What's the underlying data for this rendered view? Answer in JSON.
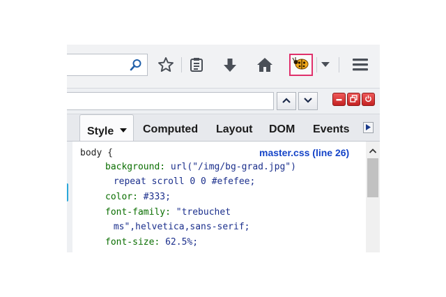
{
  "tabs": {
    "items": [
      {
        "label": "Style",
        "active": true
      },
      {
        "label": "Computed",
        "active": false
      },
      {
        "label": "Layout",
        "active": false
      },
      {
        "label": "DOM",
        "active": false
      },
      {
        "label": "Events",
        "active": false
      }
    ]
  },
  "rule": {
    "source": "master.css (line 26)",
    "selector_line": "body {",
    "declarations": [
      {
        "prop": "background:",
        "value": " url(\"/img/bg-grad.jpg\")"
      },
      {
        "prop": "",
        "value": " repeat scroll 0 0 #efefee;"
      },
      {
        "prop": "color:",
        "value": " #333;"
      },
      {
        "prop": "font-family:",
        "value": " \"trebuchet"
      },
      {
        "prop": "",
        "value": " ms\",helvetica,sans-serif;"
      },
      {
        "prop": "font-size:",
        "value": " 62.5%;"
      }
    ]
  },
  "icons": {
    "search": "search-icon",
    "bookmark": "star-icon",
    "reading_list": "clipboard-icon",
    "download": "download-arrow-icon",
    "home": "home-icon",
    "extension": "ladybug-icon",
    "menu": "hamburger-icon"
  },
  "colors": {
    "highlight_border": "#e0306b",
    "window_buttons": "#d12f2f",
    "source_link": "#1544c8"
  }
}
